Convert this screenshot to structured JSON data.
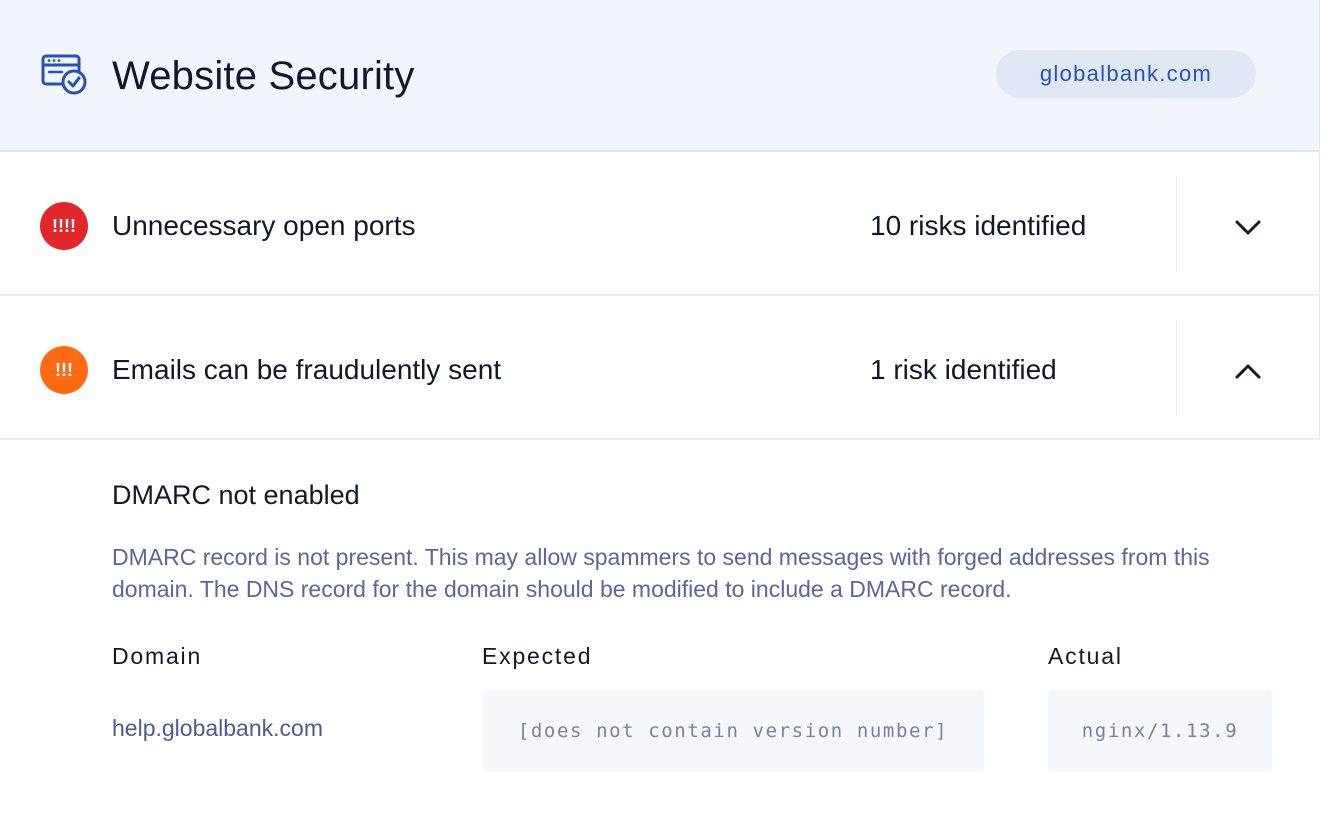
{
  "header": {
    "title": "Website Security",
    "icon": "browser-check-icon",
    "domain": "globalbank.com",
    "pill_color": "#2552b8"
  },
  "risks": [
    {
      "severity_text": "!!!!",
      "severity_color": "#e0282a",
      "title": "Unnecessary open ports",
      "count": "10 risks identified",
      "expanded": false,
      "toggle_icon": "chevron-down-icon"
    },
    {
      "severity_text": "!!!",
      "severity_color": "#ff6a13",
      "title": "Emails can be fraudulently sent",
      "count": "1 risk identified",
      "expanded": true,
      "toggle_icon": "chevron-up-icon"
    }
  ],
  "detail": {
    "title": "DMARC not enabled",
    "description": "DMARC record is not present. This may allow spammers to send messages with forged addresses from this domain. The DNS record for the domain should be modified to include a DMARC record.",
    "columns": [
      "Domain",
      "Expected",
      "Actual"
    ],
    "rows": [
      {
        "domain": "help.globalbank.com",
        "expected": "[does not contain version number]",
        "actual": "nginx/1.13.9"
      }
    ]
  }
}
